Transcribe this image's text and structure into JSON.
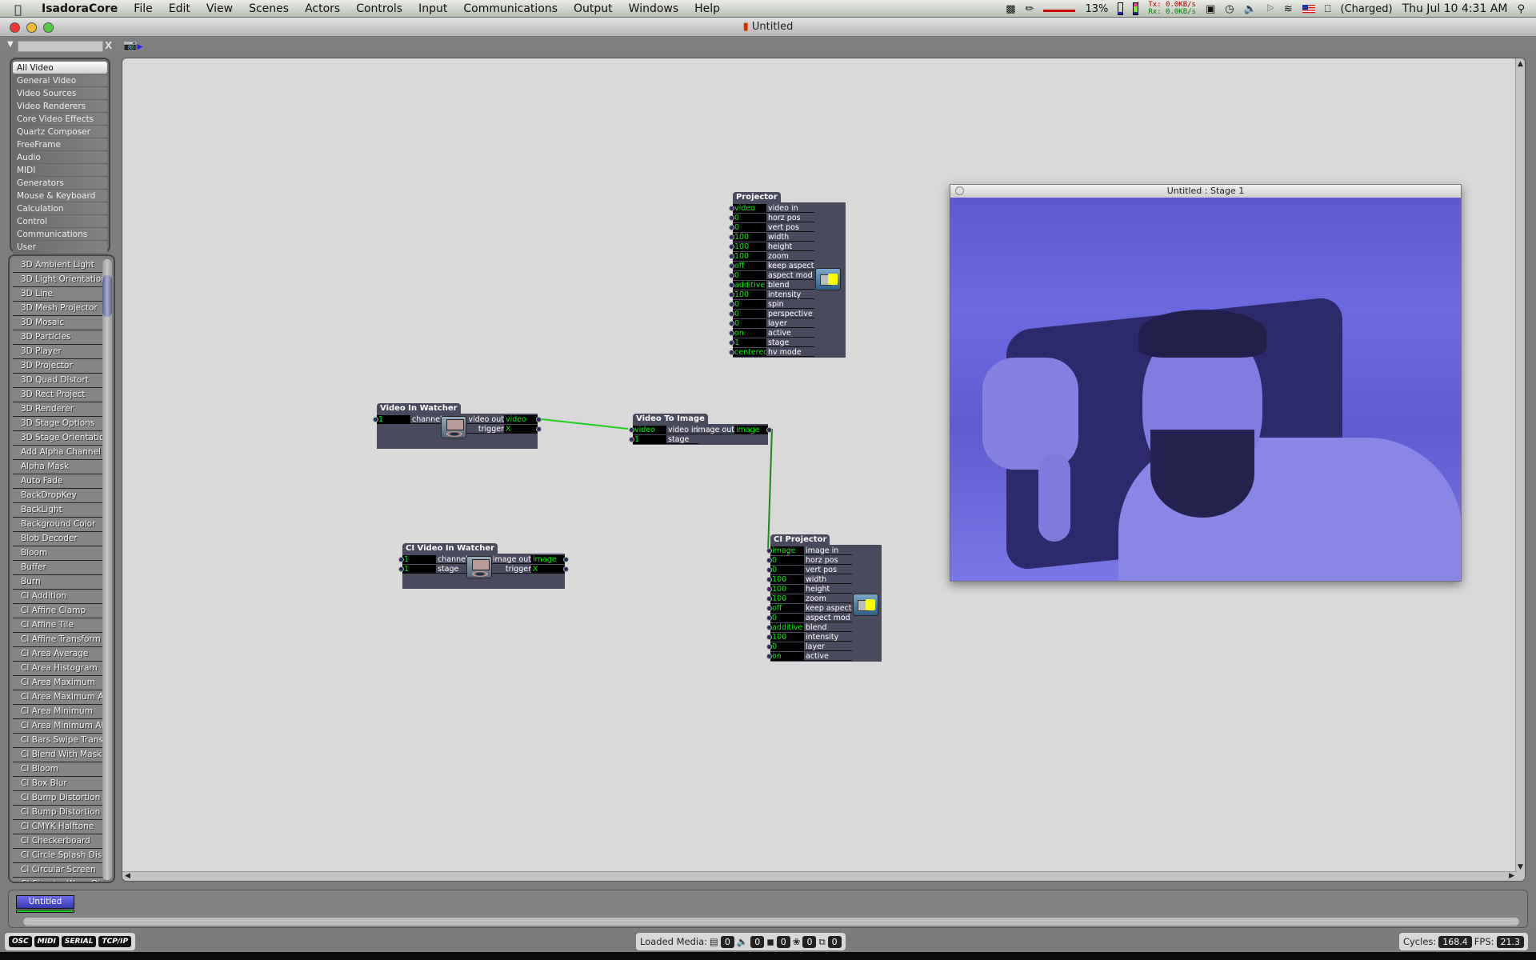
{
  "menubar": {
    "app": "IsadoraCore",
    "items": [
      "File",
      "Edit",
      "View",
      "Scenes",
      "Actors",
      "Controls",
      "Input",
      "Communications",
      "Output",
      "Windows",
      "Help"
    ],
    "battery_pct": "13%",
    "tx": "Tx:   0.0KB/s",
    "rx": "Rx:   0.0KB/s",
    "power": "(Charged)",
    "clock": "Thu Jul 10  4:31 AM"
  },
  "window": {
    "title": "Untitled"
  },
  "toolbar": {
    "filter_value": "",
    "clear_label": "X"
  },
  "categories": [
    "All Video",
    "General Video",
    "Video Sources",
    "Video Renderers",
    "Core Video Effects",
    "Quartz Composer",
    "FreeFrame",
    "Audio",
    "MIDI",
    "Generators",
    "Mouse & Keyboard",
    "Calculation",
    "Control",
    "Communications",
    "User"
  ],
  "selected_category": "All Video",
  "actor_list": [
    "3D Ambient Light",
    "3D Light Orientation",
    "3D Line",
    "3D Mesh Projector",
    "3D Mosaic",
    "3D Particles",
    "3D Player",
    "3D Projector",
    "3D Quad Distort",
    "3D Rect Project",
    "3D Renderer",
    "3D Stage Options",
    "3D Stage Orientation",
    "Add Alpha Channel",
    "Alpha Mask",
    "Auto Fade",
    "BackDropKey",
    "BackLight",
    "Background Color",
    "Blob Decoder",
    "Bloom",
    "Buffer",
    "Burn",
    "CI Addition",
    "CI Affine Clamp",
    "CI Affine Tile",
    "CI Affine Transform",
    "CI Area Average",
    "CI Area Histogram",
    "CI Area Maximum",
    "CI Area Maximum Alpha",
    "CI Area Minimum",
    "CI Area Minimum Alpha",
    "CI Bars Swipe Transition",
    "CI Blend With Mask",
    "CI Bloom",
    "CI Box Blur",
    "CI Bump Distortion",
    "CI Bump Distortion Linear",
    "CI CMYK Halftone",
    "CI Checkerboard",
    "CI Circle Splash Distortion",
    "CI Circular Screen",
    "CI Circular Wrap Distortion"
  ],
  "actors": {
    "projector": {
      "title": "Projector",
      "icon": "projector-icon",
      "inputs": [
        [
          "video",
          "video in"
        ],
        [
          "0",
          "horz pos"
        ],
        [
          "0",
          "vert pos"
        ],
        [
          "100",
          "width"
        ],
        [
          "100",
          "height"
        ],
        [
          "100",
          "zoom"
        ],
        [
          "off",
          "keep aspect"
        ],
        [
          "0",
          "aspect mod"
        ],
        [
          "additive",
          "blend"
        ],
        [
          "100",
          "intensity"
        ],
        [
          "0",
          "spin"
        ],
        [
          "0",
          "perspective"
        ],
        [
          "0",
          "layer"
        ],
        [
          "on",
          "active"
        ],
        [
          "1",
          "stage"
        ],
        [
          "centered",
          "hv mode"
        ]
      ],
      "outputs": []
    },
    "video_in_watcher": {
      "title": "Video In Watcher",
      "icon": "video-camera-icon",
      "inputs": [
        [
          "1",
          "channel"
        ]
      ],
      "outputs": [
        [
          "video out",
          "video"
        ],
        [
          "trigger",
          "X"
        ]
      ]
    },
    "video_to_image": {
      "title": "Video To Image",
      "icon": "",
      "inputs": [
        [
          "video",
          "video in"
        ],
        [
          "1",
          "stage"
        ]
      ],
      "outputs": [
        [
          "image out",
          "image"
        ]
      ]
    },
    "ci_video_in_watcher": {
      "title": "CI Video In Watcher",
      "icon": "video-camera-icon",
      "inputs": [
        [
          "1",
          "channel"
        ],
        [
          "1",
          "stage"
        ]
      ],
      "outputs": [
        [
          "image out",
          "image"
        ],
        [
          "trigger",
          "X"
        ]
      ]
    },
    "ci_projector": {
      "title": "CI Projector",
      "icon": "projector-icon",
      "inputs": [
        [
          "image",
          "image in"
        ],
        [
          "0",
          "horz pos"
        ],
        [
          "0",
          "vert pos"
        ],
        [
          "100",
          "width"
        ],
        [
          "100",
          "height"
        ],
        [
          "100",
          "zoom"
        ],
        [
          "off",
          "keep aspect"
        ],
        [
          "0",
          "aspect mod"
        ],
        [
          "additive",
          "blend"
        ],
        [
          "100",
          "intensity"
        ],
        [
          "0",
          "layer"
        ],
        [
          "on",
          "active"
        ]
      ],
      "outputs": []
    }
  },
  "stage": {
    "title": "Untitled : Stage 1"
  },
  "scenes": [
    {
      "name": "Untitled"
    }
  ],
  "statusbar": {
    "buttons": [
      "OSC",
      "MIDI",
      "SERIAL",
      "TCP/IP"
    ],
    "loaded_media_label": "Loaded Media:",
    "media_counts": [
      "0",
      "0",
      "0",
      "0",
      "0"
    ],
    "cycles_label": "Cycles:",
    "cycles": "168.4",
    "fps_label": "FPS:",
    "fps": "21.3"
  },
  "colors": {
    "wire": "#1fcf1f",
    "value_text": "#00ee00",
    "actor_body": "#4a4a5e",
    "scene_tab": "#4a4ad0"
  }
}
